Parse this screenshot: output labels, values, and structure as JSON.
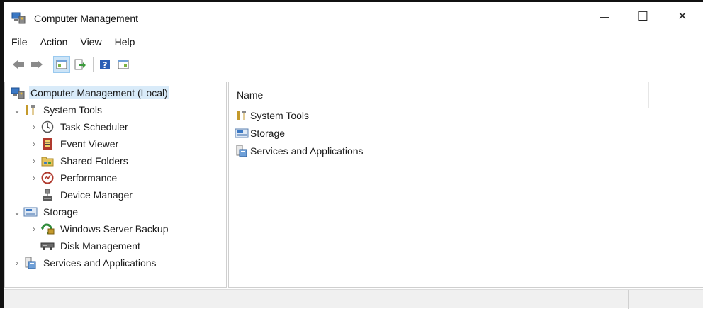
{
  "window": {
    "title": "Computer Management",
    "minimize_glyph": "—",
    "maximize_glyph": "☐",
    "close_glyph": "✕"
  },
  "menu": [
    "File",
    "Action",
    "View",
    "Help"
  ],
  "toolbar": {
    "buttons": [
      "back-arrow-icon",
      "forward-arrow-icon",
      "show-hide-console-tree-icon",
      "export-list-icon",
      "help-icon",
      "show-hide-action-pane-icon"
    ]
  },
  "tree": {
    "root": "Computer Management (Local)",
    "items": [
      {
        "label": "System Tools",
        "level": 1,
        "expand": "expanded",
        "icon": "tools-icon"
      },
      {
        "label": "Task Scheduler",
        "level": 2,
        "expand": "collapsed",
        "icon": "clock-icon"
      },
      {
        "label": "Event Viewer",
        "level": 2,
        "expand": "collapsed",
        "icon": "event-viewer-icon"
      },
      {
        "label": "Shared Folders",
        "level": 2,
        "expand": "collapsed",
        "icon": "shared-folder-icon"
      },
      {
        "label": "Performance",
        "level": 2,
        "expand": "collapsed",
        "icon": "performance-icon"
      },
      {
        "label": "Device Manager",
        "level": 2,
        "expand": "none",
        "icon": "device-manager-icon"
      },
      {
        "label": "Storage",
        "level": 1,
        "expand": "expanded",
        "icon": "storage-icon"
      },
      {
        "label": "Windows Server Backup",
        "level": 2,
        "expand": "collapsed",
        "icon": "backup-icon"
      },
      {
        "label": "Disk Management",
        "level": 2,
        "expand": "none",
        "icon": "disk-icon"
      },
      {
        "label": "Services and Applications",
        "level": 1,
        "expand": "collapsed",
        "icon": "services-icon"
      }
    ]
  },
  "list": {
    "column_name": "Name",
    "rows": [
      {
        "label": "System Tools",
        "icon": "tools-icon"
      },
      {
        "label": "Storage",
        "icon": "storage-icon"
      },
      {
        "label": "Services and Applications",
        "icon": "services-icon"
      }
    ]
  },
  "glyphs": {
    "expanded": "⌄",
    "collapsed": "›"
  }
}
